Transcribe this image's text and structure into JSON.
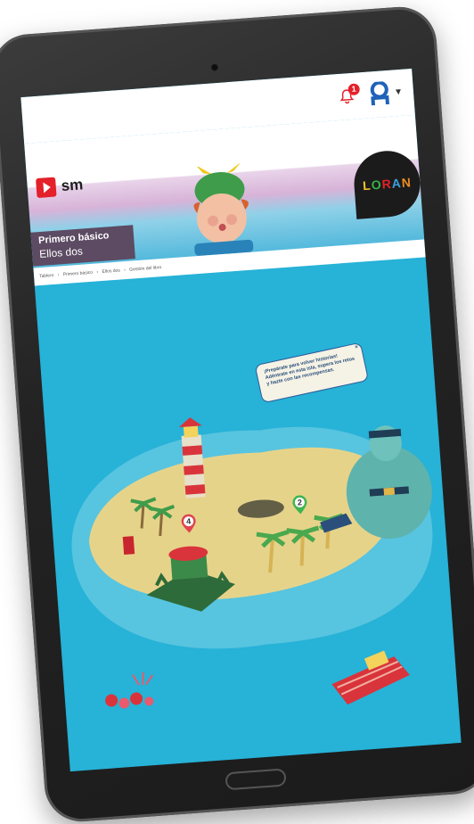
{
  "topbar": {
    "notification_count": "1"
  },
  "brand": {
    "publisher": "sm",
    "series": "LORAN"
  },
  "book": {
    "grade": "Primero básico",
    "title": "Ellos dos"
  },
  "breadcrumb": [
    "Tablero",
    "›",
    "Primero básico",
    "›",
    "Ellos dos",
    "›",
    "Gestión del libro"
  ],
  "map": {
    "speech_bubble": "¡Prepárate para volver historias! Adéntrate en esta isla, supera los retos y hazte con las recompensas.",
    "pins": [
      "4",
      "2"
    ]
  },
  "colors": {
    "sea": "#27b2d7",
    "sand": "#e6d38a",
    "accent_red": "#e4202a",
    "header_purple": "#5c4b63",
    "pin_red": "#e0434f",
    "pin_green": "#3fb552"
  }
}
